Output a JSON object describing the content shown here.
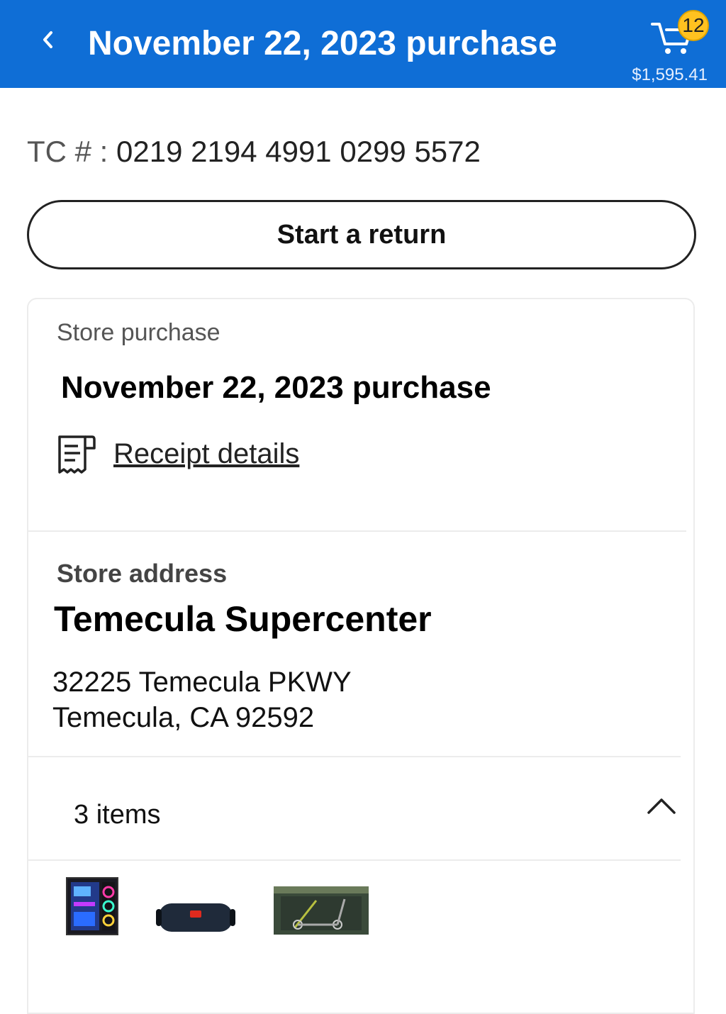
{
  "header": {
    "title": "November 22, 2023 purchase",
    "cart_count": "12",
    "cart_total": "$1,595.41",
    "back_icon": "chevron-left-icon",
    "cart_icon": "cart-icon",
    "background_color": "#0f6ed6",
    "badge_color": "#ffc220"
  },
  "transaction": {
    "label": "TC # :",
    "number": "0219 2194 4991 0299 5572"
  },
  "return_button": {
    "label": "Start a return"
  },
  "purchase": {
    "type_label": "Store purchase",
    "title": "November 22, 2023 purchase",
    "receipt_link": "Receipt details",
    "receipt_icon": "receipt-icon"
  },
  "store": {
    "label": "Store address",
    "name": "Temecula Supercenter",
    "address_line1": "32225 Temecula PKWY",
    "address_line2": "Temecula, CA 92592"
  },
  "items": {
    "count_label": "3 items",
    "toggle_icon": "chevron-up-icon",
    "thumbnails": [
      "gaming-pc-tower-image",
      "bluetooth-speaker-image",
      "skute-scooter-box-image"
    ]
  }
}
